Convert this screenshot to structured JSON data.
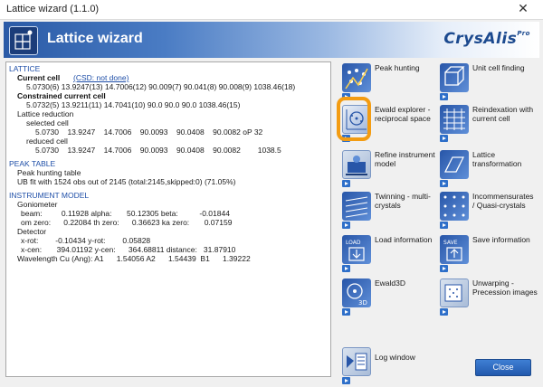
{
  "window": {
    "title": "Lattice wizard (1.1.0)",
    "close_glyph": "✕"
  },
  "banner": {
    "title": "Lattice wizard",
    "brand": "CrysAlis",
    "brand_sup": "Pro"
  },
  "left": {
    "lattice_header": "LATTICE",
    "current_cell_label": "Current cell",
    "csd_link": "(CSD: not done)",
    "current_cell_values": "5.0730(6) 13.9247(13) 14.7006(12) 90.009(7) 90.041(8) 90.008(9) 1038.46(18)",
    "constrained_label": "Constrained current cell",
    "constrained_values": "5.0732(5) 13.9211(11) 14.7041(10) 90.0 90.0 90.0 1038.46(15)",
    "reduction_label": "Lattice reduction",
    "selected_label": "selected cell",
    "selected_values": "5.0730    13.9247    14.7006    90.0093    90.0408    90.0082 oP 32",
    "reduced_label": "reduced cell",
    "reduced_values": "5.0730    13.9247    14.7006    90.0093    90.0408    90.0082        1038.5",
    "peak_header": "PEAK TABLE",
    "peak_line1": "Peak hunting table",
    "peak_line2": "UB fit with 1524 obs out of 2145 (total:2145,skipped:0) (71.05%)",
    "instrument_header": "INSTRUMENT MODEL",
    "goniometer_label": "Goniometer",
    "beam_line": "beam:         0.11928 alpha:       50.12305 beta:          -0.01844",
    "om_line": "om zero:      0.22084 th zero:      0.36623 ka zero:       0.07159",
    "detector_label": "Detector",
    "xrot_line": "x-rot:        -0.10434 y-rot:        0.05828",
    "xcen_line": "x-cen:       394.01192 y-cen:      364.68811 distance:   31.87910",
    "wavelength_line": "Wavelength Cu (Ang): A1      1.54056 A2      1.54439  B1      1.39222"
  },
  "tools": [
    {
      "id": "peak-hunting",
      "label": "Peak hunting"
    },
    {
      "id": "unit-cell-finding",
      "label": "Unit cell finding"
    },
    {
      "id": "ewald-explorer",
      "label": "Ewald explorer - reciprocal space"
    },
    {
      "id": "reindexation",
      "label": "Reindexation with current cell"
    },
    {
      "id": "refine-instrument",
      "label": "Refine instrument model"
    },
    {
      "id": "lattice-transform",
      "label": "Lattice transformation"
    },
    {
      "id": "twinning",
      "label": "Twinning - multi-crystals"
    },
    {
      "id": "incommensurates",
      "label": "Incommensurates / Quasi-crystals"
    },
    {
      "id": "load-information",
      "label": "Load information"
    },
    {
      "id": "save-information",
      "label": "Save information"
    },
    {
      "id": "ewald3d",
      "label": "Ewald3D"
    },
    {
      "id": "unwarping",
      "label": "Unwarping - Precession images"
    },
    {
      "id": "log-window",
      "label": "Log window"
    }
  ],
  "icon_tags": {
    "load": "LOAD",
    "save": "SAVE",
    "3d": "3D"
  },
  "buttons": {
    "close_label": "Close"
  }
}
